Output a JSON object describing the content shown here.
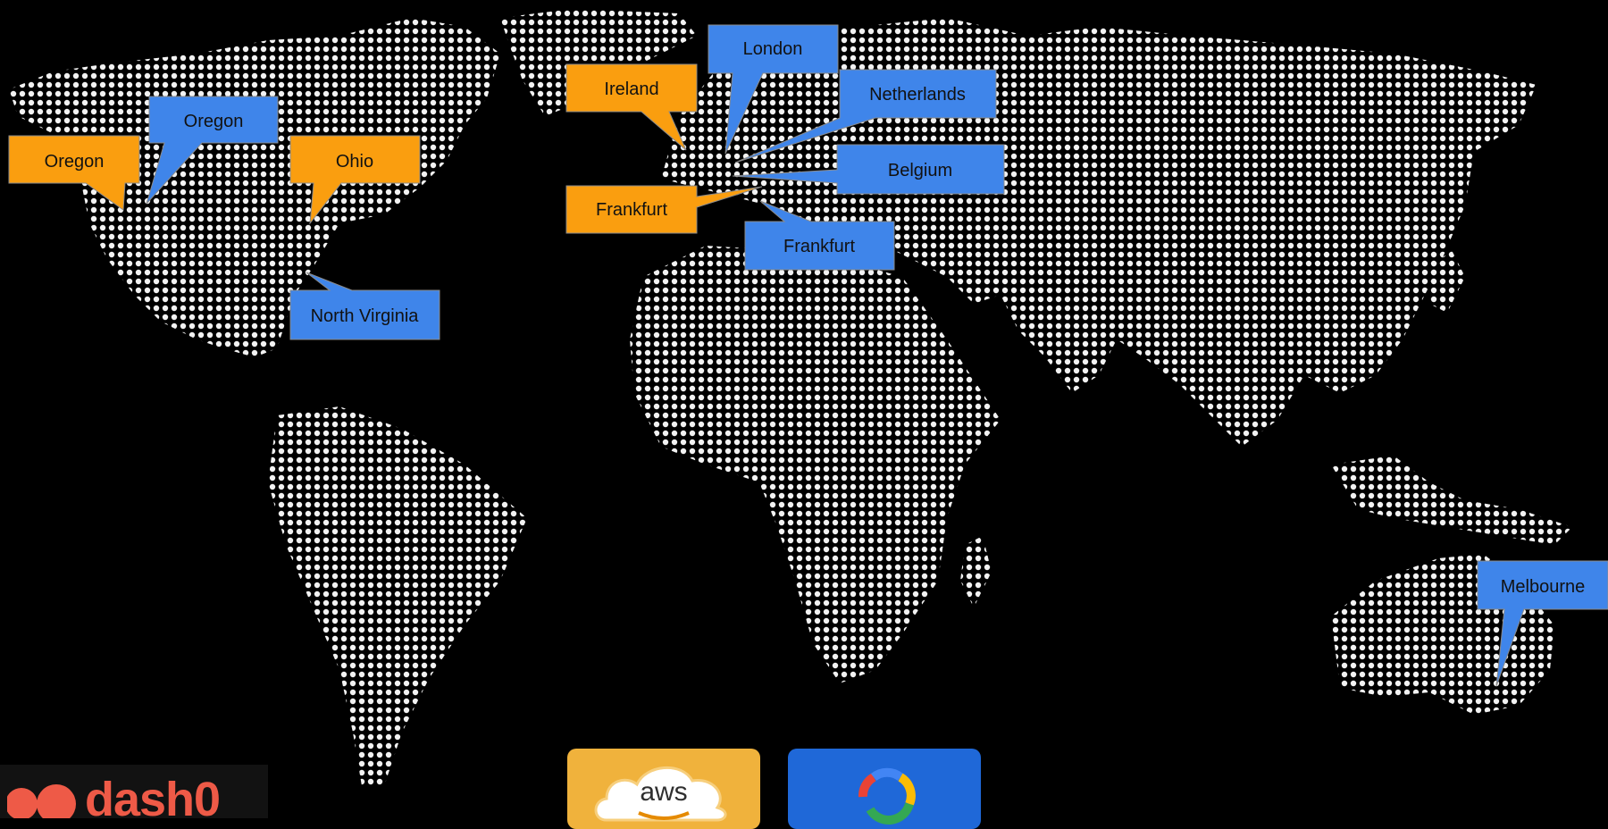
{
  "map": {
    "colors": {
      "background": "#000000",
      "land_dots": "#f2f2f2",
      "callout_aws": "#fa9e0f",
      "callout_gcp": "#3f85ea",
      "callout_border": "#8a8a8a",
      "text": "#111111"
    },
    "labels": {
      "aws_oregon": "Oregon",
      "gcp_oregon": "Oregon",
      "aws_ohio": "Ohio",
      "gcp_north_virginia": "North Virginia",
      "aws_ireland": "Ireland",
      "gcp_london": "London",
      "gcp_netherlands": "Netherlands",
      "gcp_belgium": "Belgium",
      "aws_frankfurt": "Frankfurt",
      "gcp_frankfurt": "Frankfurt",
      "gcp_melbourne": "Melbourne"
    }
  },
  "footer": {
    "logo_text": "dash0",
    "aws_label": "aws",
    "gcp_icon": "google-cloud-icon",
    "aws_icon": "aws-icon"
  }
}
